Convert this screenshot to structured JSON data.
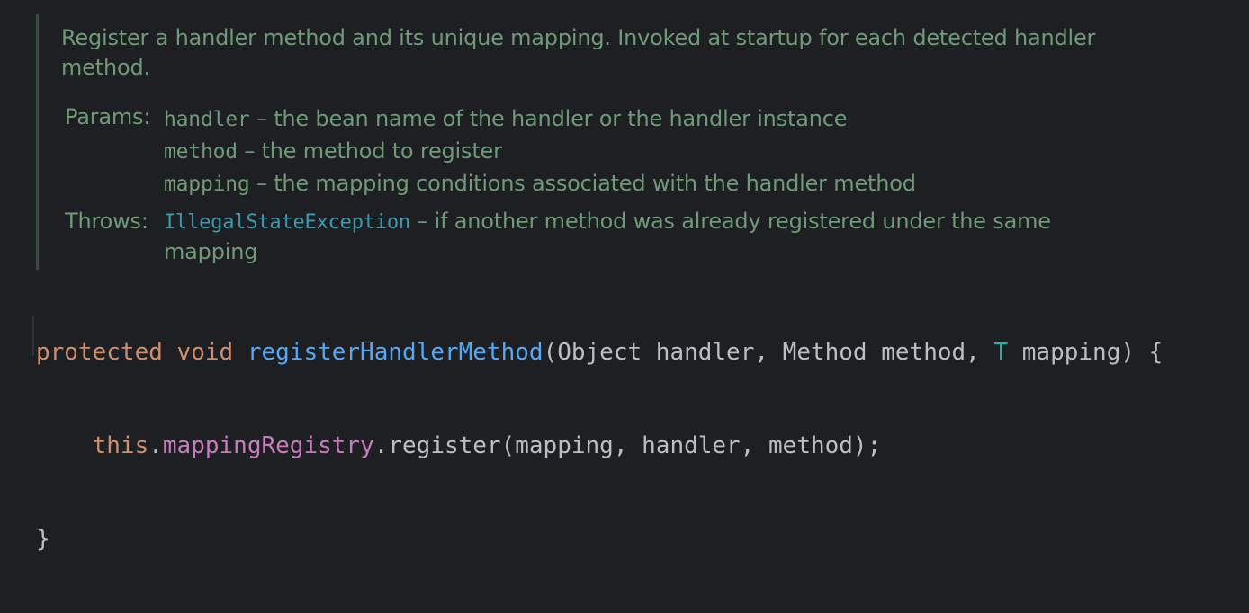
{
  "doc": {
    "description": "Register a handler method and its unique mapping. Invoked at startup for each detected handler method.",
    "params_label": "Params:",
    "params": [
      {
        "name": "handler",
        "sep": " – ",
        "text": "the bean name of the handler or the handler instance"
      },
      {
        "name": "method",
        "sep": " – ",
        "text": "the method to register"
      },
      {
        "name": "mapping",
        "sep": " – ",
        "text": "the mapping conditions associated with the handler method"
      }
    ],
    "throws_label": "Throws:",
    "throws": {
      "name": "IllegalStateException",
      "sep": " – ",
      "text": "if another method was already registered under the same mapping"
    }
  },
  "code": {
    "line1": {
      "kw_protected": "protected",
      "sp1": " ",
      "kw_void": "void",
      "sp2": " ",
      "method_name": "registerHandlerMethod",
      "args_a": "(Object handler, Method method, ",
      "type_param": "T",
      "args_b": " mapping) {"
    },
    "line2": {
      "indent": "    ",
      "kw_this": "this",
      "dot": ".",
      "field": "mappingRegistry",
      "rest": ".register(mapping, handler, method);"
    },
    "line3": {
      "brace": "}"
    }
  },
  "colors": {
    "background": "#1e1f22",
    "doc_text": "#6f9a79",
    "doc_link": "#3a9bb0",
    "keyword": "#cf8e6d",
    "method": "#56a8f5",
    "field": "#c77dbb",
    "type_param": "#16baac",
    "plain": "#bcbec4"
  }
}
